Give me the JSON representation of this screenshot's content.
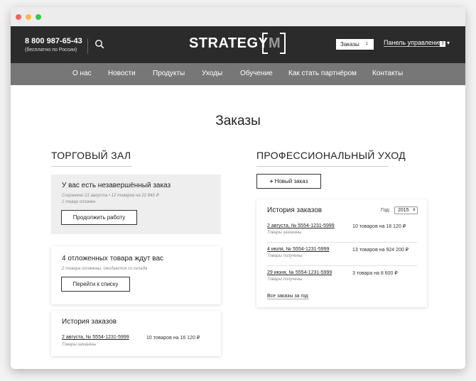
{
  "header": {
    "phone": "8 800 987-65-43",
    "phone_note": "(бесплатно по России)",
    "logo_text": "STRATEGY",
    "logo_mark": "M",
    "orders_label": "Заказы",
    "orders_count": "1",
    "panel_label": "Панель управления",
    "panel_badge": "3"
  },
  "nav": [
    "О нас",
    "Новости",
    "Продукты",
    "Уходы",
    "Обучение",
    "Как стать партнёром",
    "Контакты"
  ],
  "page_title": "Заказы",
  "left": {
    "title": "ТОРГОВЫЙ ЗАЛ",
    "draft": {
      "title": "У вас есть незавершённый заказ",
      "meta1": "Сохранено 21 августа • 12 товаров на 22 840 ₽",
      "meta2": "1 товар оплачен",
      "button": "Продолжить работу"
    },
    "postponed": {
      "title": "4 отложенных товара ждут вас",
      "meta": "2 товара оплачены, ожидаются со склада",
      "button": "Перейти к списку"
    },
    "history": {
      "title": "История заказов",
      "order_link": "2 августа, № 5554-1231-5999",
      "order_status": "Товары заказаны",
      "order_summary": "10 товаров на 16 120 ₽"
    }
  },
  "right": {
    "title": "ПРОФЕССИОНАЛЬНЫЙ УХОД",
    "new_order": "Новый заказ",
    "history": {
      "title": "История заказов",
      "year_label": "Год:",
      "year_value": "2015",
      "orders": [
        {
          "link": "2 августа, № 5554-1231-5999",
          "status": "Товары заказаны",
          "summary": "10 товаров на 16 120 ₽"
        },
        {
          "link": "4 июля, № 5554-1231-5999",
          "status": "Товары получены",
          "summary": "13 товаров на 924 200 ₽"
        },
        {
          "link": "29 июня, № 5554-1231-5999",
          "status": "Товары получены",
          "summary": "3 товара на 8 600 ₽"
        }
      ],
      "all_orders": "Все заказы за год"
    }
  }
}
